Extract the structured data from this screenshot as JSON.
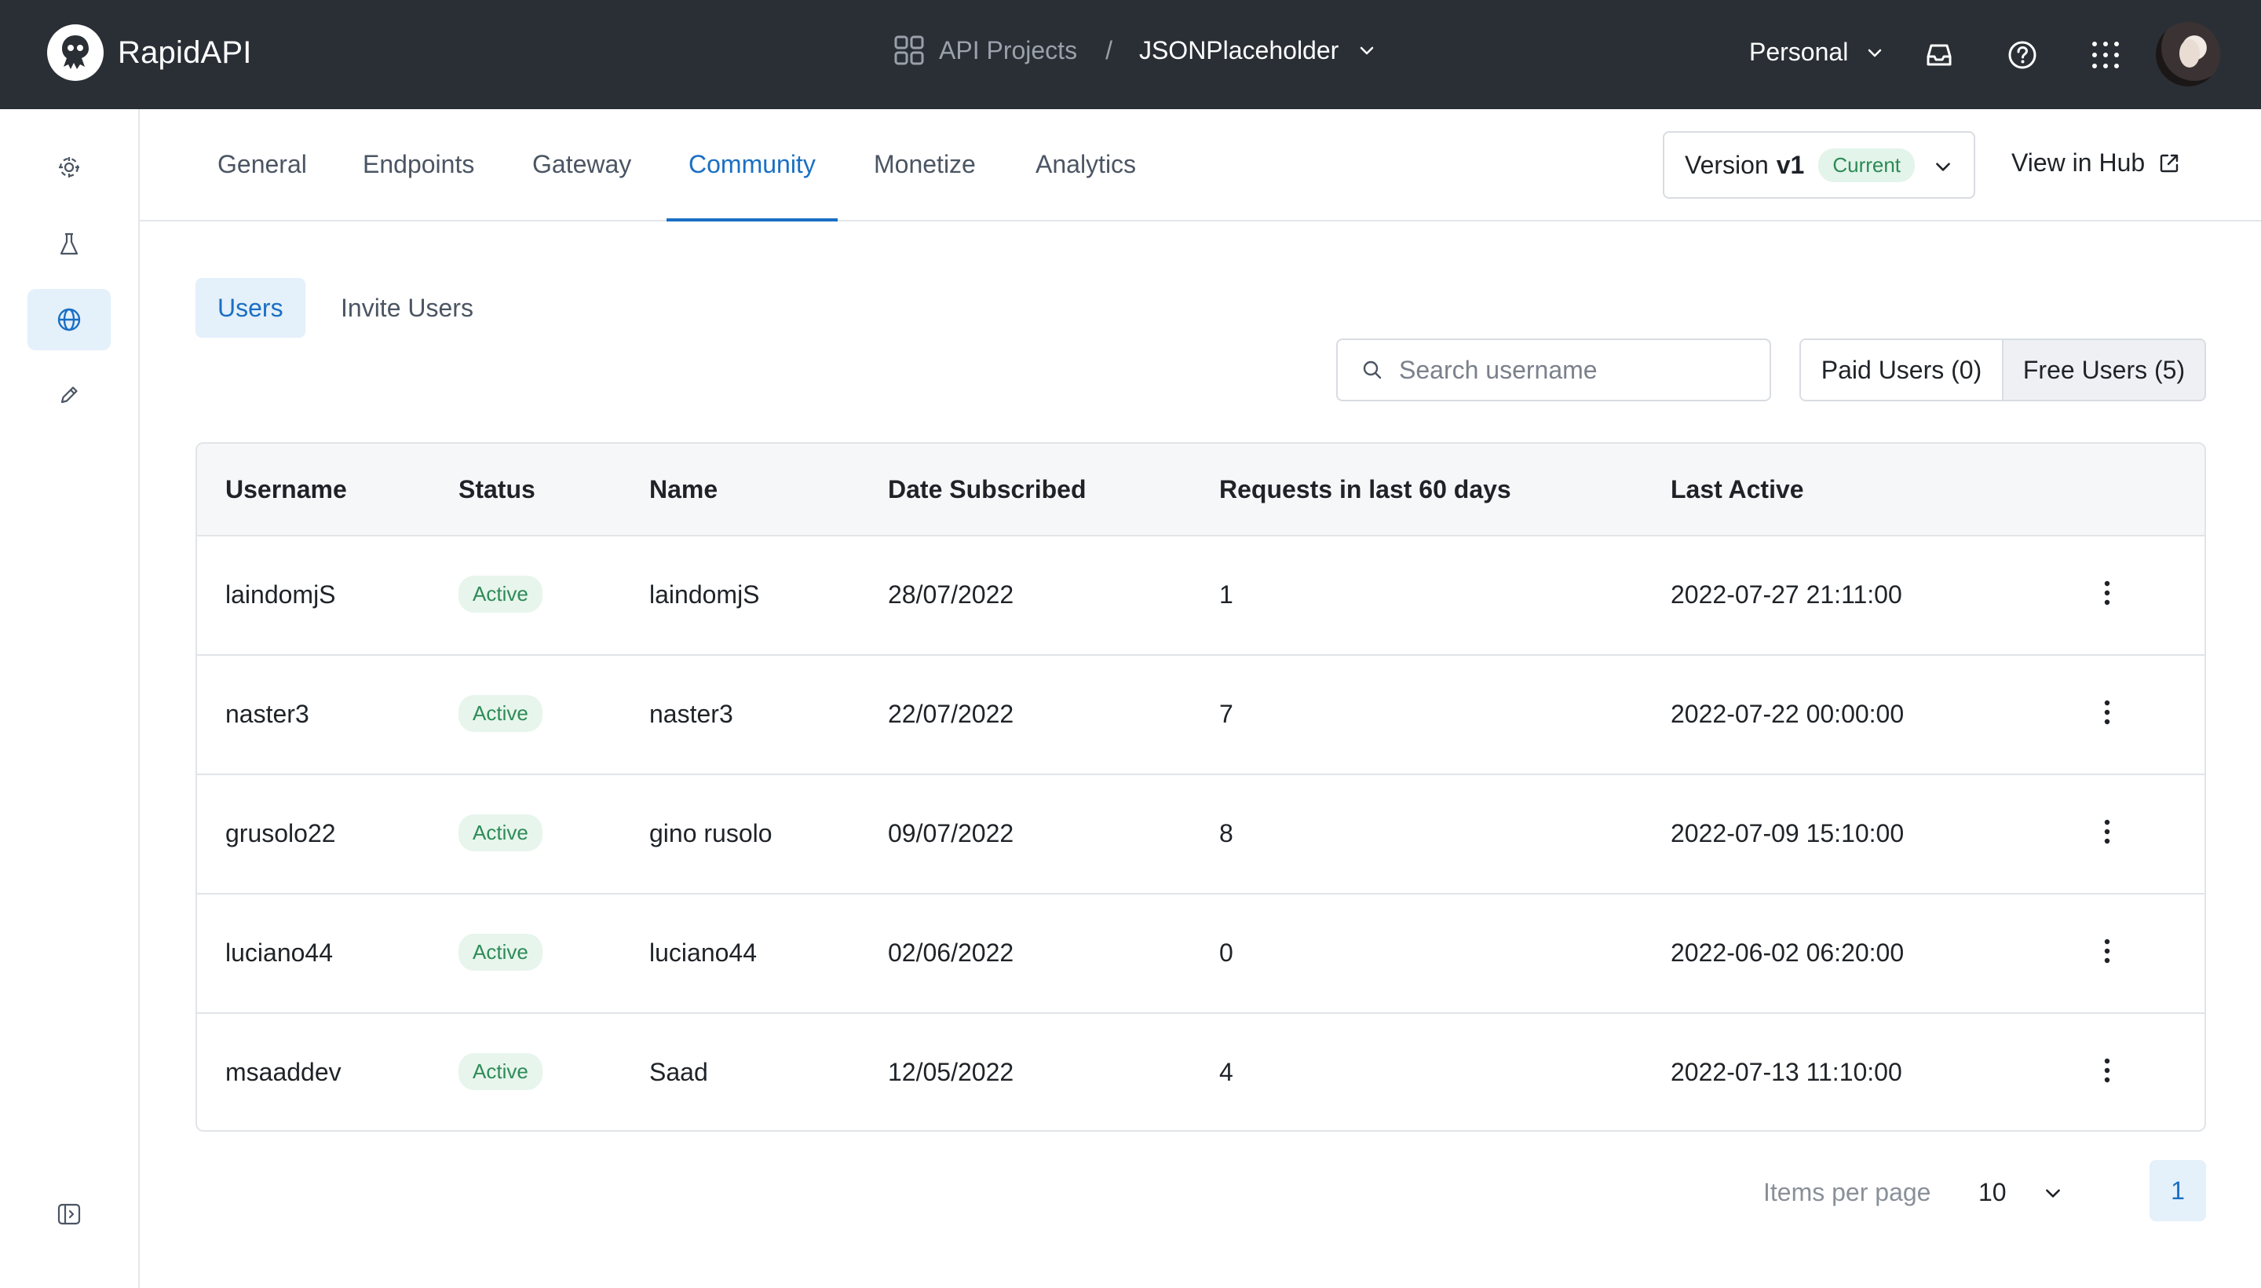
{
  "app": {
    "name": "RapidAPI"
  },
  "breadcrumb": {
    "projects_label": "API Projects",
    "separator": "/",
    "current": "JSONPlaceholder"
  },
  "header": {
    "workspace": "Personal"
  },
  "tabs": [
    {
      "label": "General"
    },
    {
      "label": "Endpoints"
    },
    {
      "label": "Gateway"
    },
    {
      "label": "Community",
      "active": true
    },
    {
      "label": "Monetize"
    },
    {
      "label": "Analytics"
    }
  ],
  "version": {
    "prefix": "Version",
    "value": "v1",
    "badge": "Current"
  },
  "view_hub": "View in Hub",
  "subtabs": [
    {
      "label": "Users",
      "active": true
    },
    {
      "label": "Invite Users"
    }
  ],
  "search": {
    "placeholder": "Search username",
    "value": ""
  },
  "filters": {
    "paid": "Paid Users (0)",
    "free": "Free Users (5)",
    "selected": "free"
  },
  "table": {
    "headers": [
      "Username",
      "Status",
      "Name",
      "Date Subscribed",
      "Requests in last 60 days",
      "Last Active"
    ],
    "rows": [
      {
        "username": "laindomjS",
        "status": "Active",
        "name": "laindomjS",
        "date": "28/07/2022",
        "requests": "1",
        "last_active": "2022-07-27 21:11:00"
      },
      {
        "username": "naster3",
        "status": "Active",
        "name": "naster3",
        "date": "22/07/2022",
        "requests": "7",
        "last_active": "2022-07-22 00:00:00"
      },
      {
        "username": "grusolo22",
        "status": "Active",
        "name": "gino rusolo",
        "date": "09/07/2022",
        "requests": "8",
        "last_active": "2022-07-09 15:10:00"
      },
      {
        "username": "luciano44",
        "status": "Active",
        "name": "luciano44",
        "date": "02/06/2022",
        "requests": "0",
        "last_active": "2022-06-02 06:20:00"
      },
      {
        "username": "msaaddev",
        "status": "Active",
        "name": "Saad",
        "date": "12/05/2022",
        "requests": "4",
        "last_active": "2022-07-13 11:10:00"
      }
    ]
  },
  "pagination": {
    "items_per_page_label": "Items per page",
    "items_per_page": "10",
    "current_page": "1"
  },
  "colors": {
    "topbar": "#2a2f36",
    "accent": "#1a6fc4",
    "active_bg": "#e4f0fa",
    "status_green": "#2e8b57"
  },
  "icons": {
    "rail": [
      "hub-icon",
      "flask-icon",
      "globe-icon",
      "pencil-icon",
      "collapse-sidebar-icon"
    ],
    "topbar": [
      "grid-icon",
      "inbox-icon",
      "help-icon",
      "apps-icon"
    ]
  }
}
